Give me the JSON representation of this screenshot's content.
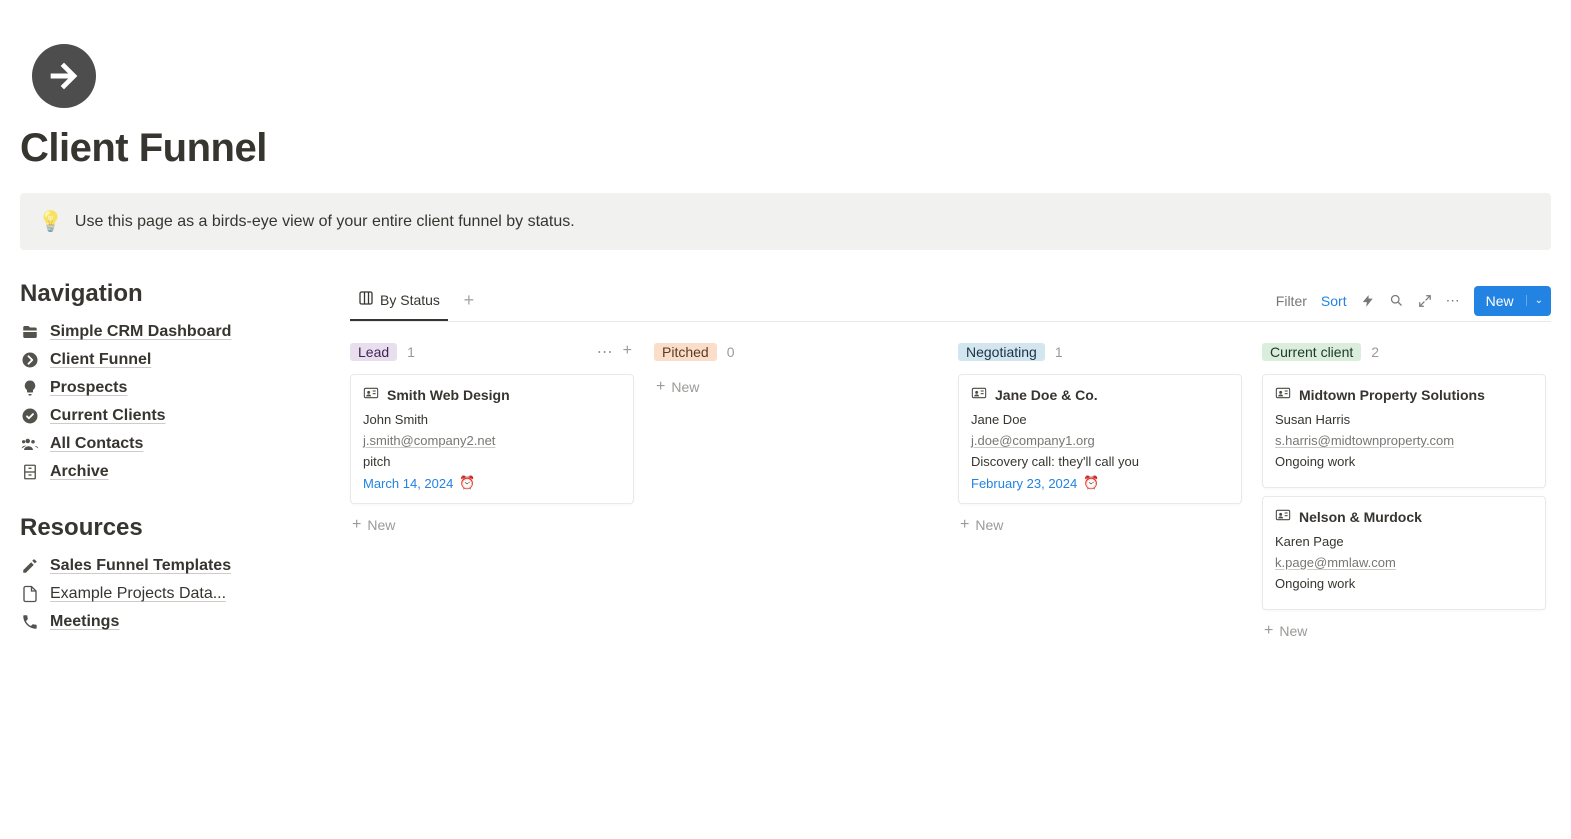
{
  "page": {
    "title": "Client Funnel"
  },
  "callout": {
    "icon": "💡",
    "text": "Use this page as a birds-eye view of your entire client funnel by status."
  },
  "sidebar": {
    "navigation_heading": "Navigation",
    "resources_heading": "Resources",
    "nav_items": [
      {
        "icon": "🗂️",
        "label": "Simple CRM Dashboard",
        "bold": true
      },
      {
        "icon": "➡️",
        "label": "Client Funnel",
        "bold": true
      },
      {
        "icon": "💡",
        "label": "Prospects",
        "bold": true
      },
      {
        "icon": "✔️",
        "label": "Current Clients",
        "bold": true
      },
      {
        "icon": "👥",
        "label": "All Contacts",
        "bold": true
      },
      {
        "icon": "🗄️",
        "label": "Archive",
        "bold": true
      }
    ],
    "resource_items": [
      {
        "icon": "✏️",
        "label": "Sales Funnel Templates",
        "bold": true
      },
      {
        "icon": "📄",
        "label": "Example Projects Data...",
        "bold": false
      },
      {
        "icon": "📞",
        "label": "Meetings",
        "bold": true
      }
    ]
  },
  "view": {
    "tab_label": "By Status",
    "filter_label": "Filter",
    "sort_label": "Sort",
    "new_button": "New"
  },
  "board": {
    "new_label": "New",
    "columns": [
      {
        "name": "Lead",
        "tag_class": "tag-lead",
        "count": "1",
        "show_hover": true,
        "cards": [
          {
            "title": "Smith Web Design",
            "contact": "John Smith",
            "email": "j.smith@company2.net",
            "note": "pitch",
            "date": "March 14, 2024"
          }
        ]
      },
      {
        "name": "Pitched",
        "tag_class": "tag-pitched",
        "count": "0",
        "show_hover": false,
        "cards": []
      },
      {
        "name": "Negotiating",
        "tag_class": "tag-negotiating",
        "count": "1",
        "show_hover": false,
        "cards": [
          {
            "title": "Jane Doe & Co.",
            "contact": "Jane Doe",
            "email": "j.doe@company1.org",
            "note": "Discovery call: they'll call you",
            "date": "February 23, 2024"
          }
        ]
      },
      {
        "name": "Current client",
        "tag_class": "tag-client",
        "count": "2",
        "show_hover": false,
        "cards": [
          {
            "title": "Midtown Property Solutions",
            "contact": "Susan Harris",
            "email": "s.harris@midtownproperty.com",
            "note": "Ongoing work",
            "date": null
          },
          {
            "title": "Nelson & Murdock",
            "contact": "Karen Page",
            "email": "k.page@mmlaw.com",
            "note": "Ongoing work",
            "date": null
          }
        ]
      }
    ]
  }
}
